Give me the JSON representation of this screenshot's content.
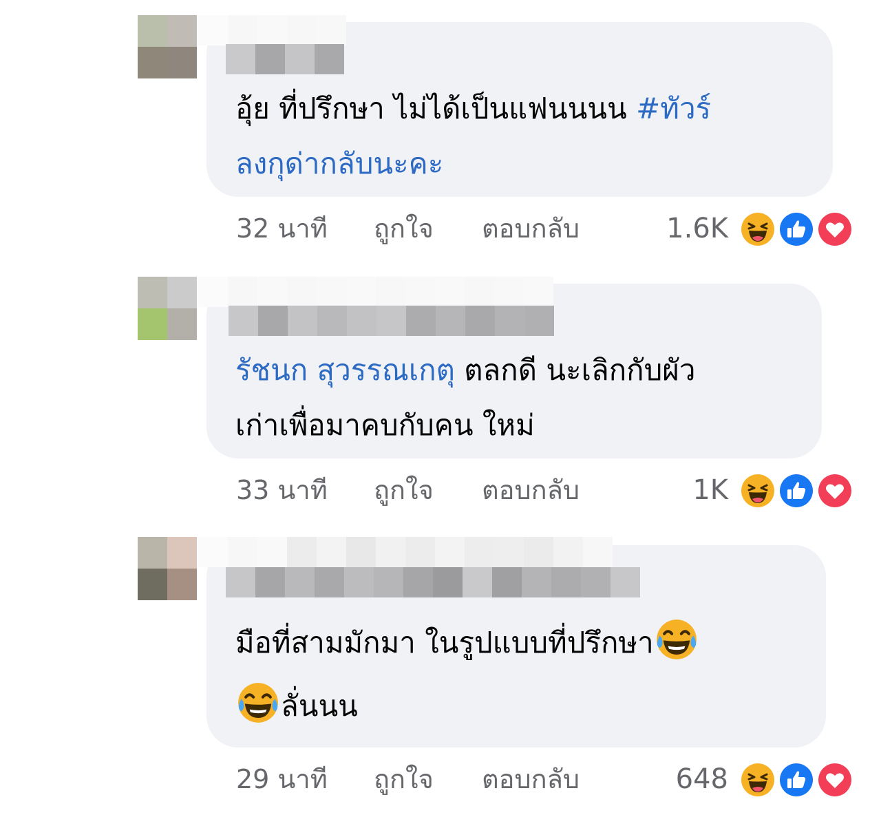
{
  "comments": [
    {
      "text_line1_prefix": "อุ้ย ที่ปรึกษา ไม่ได้เป็นแฟนนนน ",
      "hashtag_part1": "#ทัวร์",
      "hashtag_part2": "ลงกุด่ากลับนะคะ",
      "time": "32 นาที",
      "like_label": "ถูกใจ",
      "reply_label": "ตอบกลับ",
      "reaction_count": "1.6K"
    },
    {
      "mention": "รัชนก สุวรรณเกตุ",
      "text_line1_suffix": " ตลกดี นะเลิกกับผัว",
      "text_line2": "เก่าเพื่อมาคบกับคน ใหม่",
      "time": "33 นาที",
      "like_label": "ถูกใจ",
      "reply_label": "ตอบกลับ",
      "reaction_count": "1K"
    },
    {
      "text_line1": "มือที่สามมักมา ในรูปแบบที่ปรึกษา",
      "text_line2": "ลั่นนน",
      "time": "29 นาที",
      "like_label": "ถูกใจ",
      "reply_label": "ตอบกลับ",
      "reaction_count": "648"
    }
  ],
  "reactions": [
    "haha-icon",
    "like-icon",
    "love-icon"
  ],
  "colors": {
    "bubble": "#f0f2f5",
    "link": "#2d6ac4",
    "meta": "#65676b",
    "text": "#050505",
    "like": "#1877f2",
    "love": "#f33e58",
    "haha": "#f7b125"
  }
}
